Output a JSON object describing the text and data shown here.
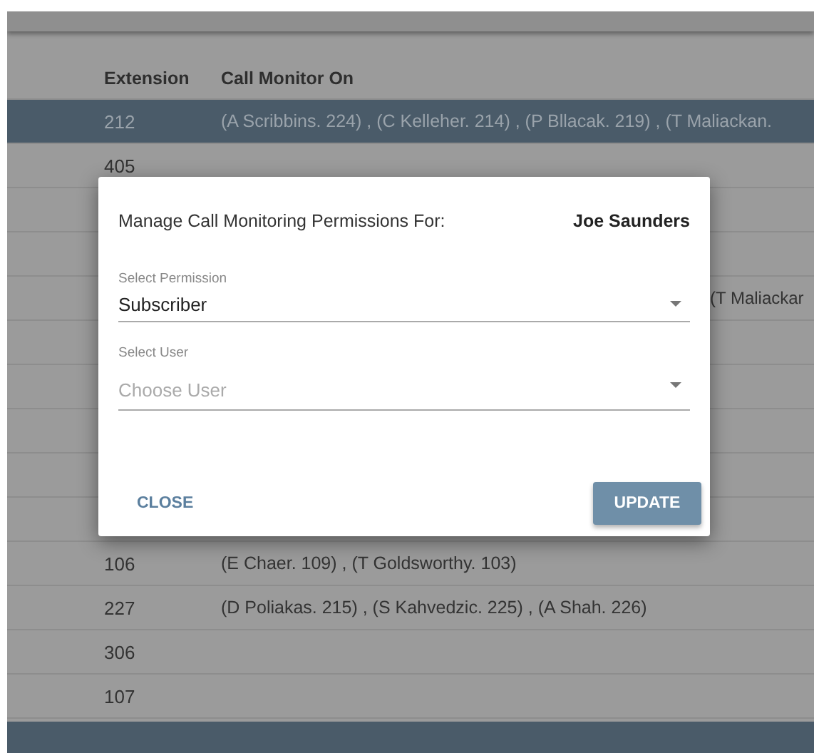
{
  "table": {
    "columns": [
      "Extension",
      "Call Monitor On"
    ],
    "rows": [
      {
        "extension": "212",
        "call_monitor_on": "(A Scribbins. 224) , (C Kelleher. 214) , (P Bllacak. 219) , (T Maliackan.",
        "selected": true
      },
      {
        "extension": "405",
        "selected": false
      },
      {
        "selected": false
      },
      {
        "selected": false
      },
      {
        "call_monitor_on_tail": "(T Maliackar",
        "selected": false
      },
      {
        "selected": false
      },
      {
        "selected": false
      },
      {
        "selected": false
      },
      {
        "selected": false
      },
      {
        "selected": false
      },
      {
        "extension": "106",
        "call_monitor_on": "(E Chaer. 109) , (T Goldsworthy. 103)",
        "selected": false
      },
      {
        "extension": "227",
        "call_monitor_on": "(D Poliakas. 215) , (S Kahvedzic. 225) , (A Shah. 226)",
        "selected": false
      },
      {
        "extension": "306",
        "selected": false
      },
      {
        "extension": "107",
        "selected": false
      }
    ]
  },
  "dialog": {
    "title": "Manage Call Monitoring Permissions For:",
    "user_name": "Joe Saunders",
    "fields": [
      {
        "label": "Select Permission",
        "value": "Subscriber"
      },
      {
        "label": "Select User",
        "placeholder": "Choose User"
      }
    ],
    "buttons": [
      {
        "label": "CLOSE",
        "kind": "text"
      },
      {
        "label": "UPDATE",
        "kind": "raised"
      }
    ]
  }
}
